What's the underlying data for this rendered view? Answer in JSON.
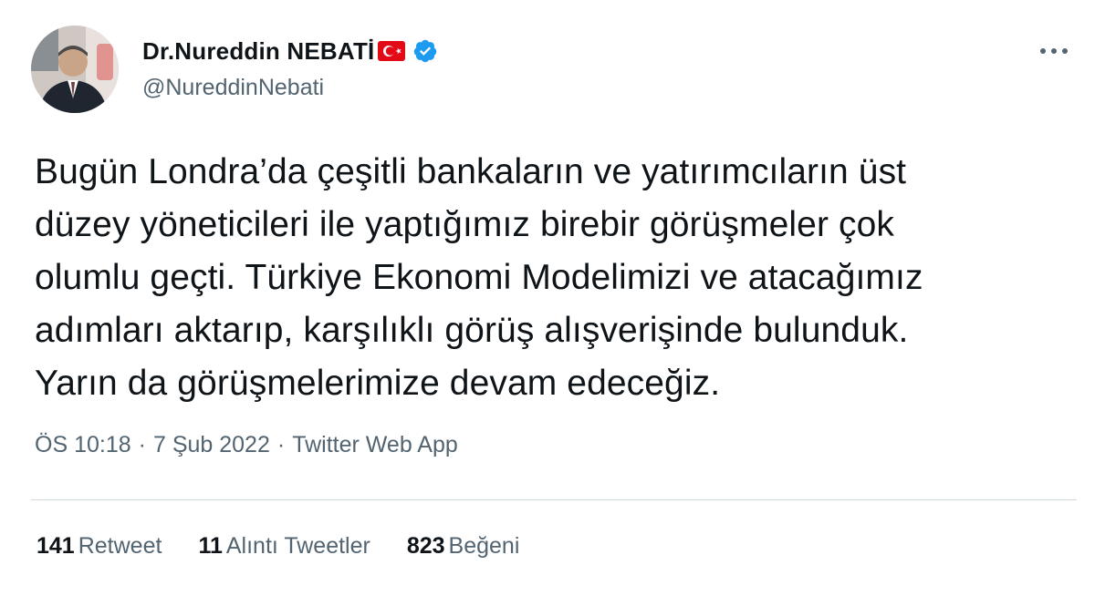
{
  "user": {
    "display_name": "Dr.Nureddin NEBATİ",
    "handle": "@NureddinNebati",
    "flag_icon": "turkey-flag-icon",
    "verified_icon": "verified-badge-icon"
  },
  "tweet": {
    "text": "Bugün Londra’da çeşitli bankaların ve yatırımcıların üst\ndüzey yöneticileri ile yaptığımız birebir görüşmeler çok\nolumlu geçti. Türkiye Ekonomi Modelimizi ve atacağımız\nadımları aktarıp, karşılıklı görüş alışverişinde bulunduk.\nYarın da görüşmelerimize devam edeceğiz.",
    "time": "ÖS 10:18",
    "separator": "·",
    "date": "7 Şub 2022",
    "source": "Twitter Web App"
  },
  "stats": {
    "retweets_count": "141",
    "retweets_label": "Retweet",
    "quotes_count": "11",
    "quotes_label": "Alıntı Tweetler",
    "likes_count": "823",
    "likes_label": "Beğeni"
  },
  "colors": {
    "text": "#0f1419",
    "secondary": "#536471",
    "verified": "#1d9bf0",
    "flag_red": "#e30a17",
    "divider": "#cfd9de"
  }
}
